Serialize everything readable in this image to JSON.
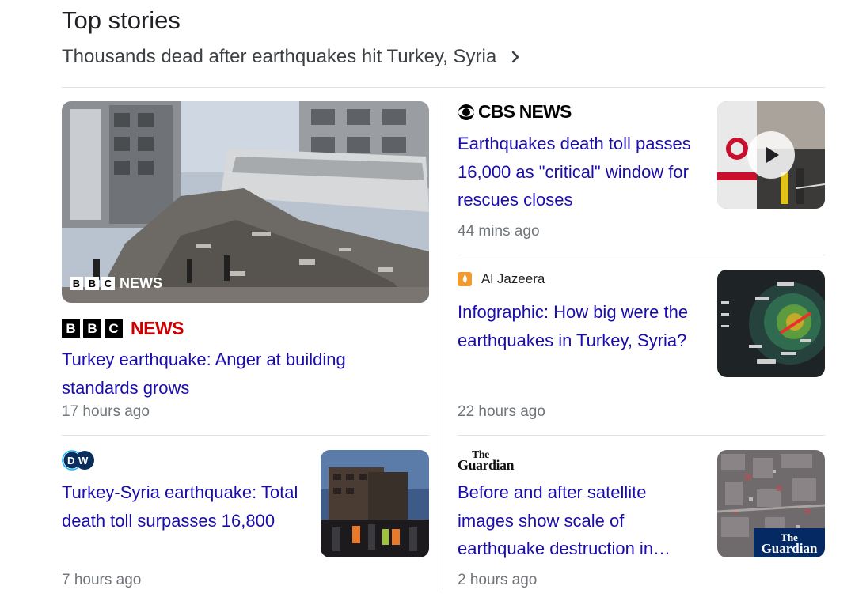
{
  "section": {
    "title": "Top stories",
    "subheading": "Thousands dead after earthquakes hit Turkey, Syria"
  },
  "stories": [
    {
      "source": "BBC NEWS",
      "source_logo_letters": [
        "B",
        "B",
        "C"
      ],
      "source_logo_word": "NEWS",
      "thumb_overlay": "NEWS",
      "headline": "Turkey earthquake: Anger at building standards grows",
      "time": "17 hours ago"
    },
    {
      "source": "CBS NEWS",
      "headline": "Earthquakes death toll passes 16,000 as \"critical\" window for rescues closes",
      "time": "44 mins ago",
      "has_video": true
    },
    {
      "source": "Al Jazeera",
      "headline": "Infographic: How big were the earthquakes in Turkey, Syria?",
      "time": "22 hours ago"
    },
    {
      "source": "DW",
      "headline": "Turkey-Syria earthquake: Total death toll surpasses 16,800",
      "time": "7 hours ago"
    },
    {
      "source": "The Guardian",
      "source_logo_top": "The",
      "source_logo_bottom": "Guardian",
      "headline": "Before and after satellite images show scale of earthquake destruction in…",
      "time": "2 hours ago"
    }
  ],
  "colors": {
    "link": "#1a0dab",
    "bbc_red": "#cc0000",
    "guardian_blue": "#052962",
    "aljazeera_orange": "#f29a2e"
  }
}
